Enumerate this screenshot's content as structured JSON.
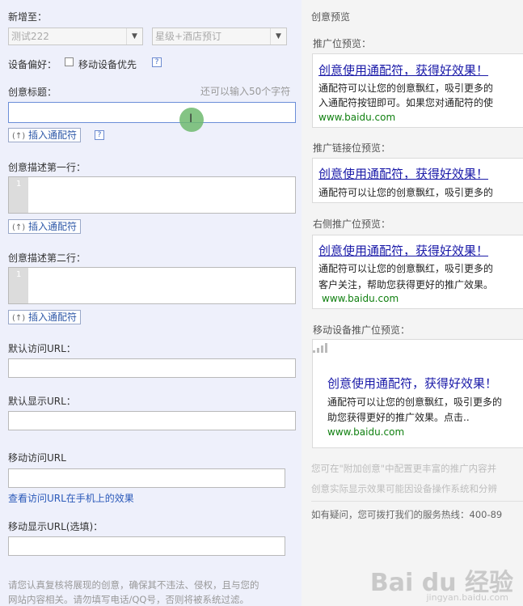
{
  "form": {
    "add_to_label": "新增至：",
    "plan_select": "测试222",
    "unit_select": "星级+酒店预订",
    "device_pref_label": "设备偏好：",
    "device_pref_option": "移动设备优先",
    "help_glyph": "?",
    "title_label": "创意标题：",
    "char_hint": "还可以输入50个字符",
    "insert_icon": "(↑)",
    "insert_wildcard": "插入通配符",
    "desc1_label": "创意描述第一行：",
    "desc2_label": "创意描述第二行：",
    "line_number": "1",
    "default_url_label": "默认访问URL：",
    "default_display_url_label": "默认显示URL：",
    "mobile_url_label": "移动访问URL",
    "view_url_link": "查看访问URL在手机上的效果",
    "mobile_display_url_label": "移动显示URL(选填)：",
    "notice_line1": "请您认真复核将展现的创意，确保其不违法、侵权，且与您的",
    "notice_line2": "网站内容相关。请勿填写电话/QQ号，否则将被系统过滤。"
  },
  "preview": {
    "header": "创意预览",
    "promo_label": "推广位预览：",
    "link_label": "推广链接位预览：",
    "right_label": "右侧推广位预览：",
    "mobile_label": "移动设备推广位预览：",
    "ad_title": "创意使用通配符，获得好效果！",
    "card1_desc1": "通配符可以让您的创意飘红，吸引更多的",
    "card1_desc2": "入通配符按钮即可。如果您对通配符的使",
    "card2_desc1": "通配符可以让您的创意飘红，吸引更多的",
    "card3_desc1": "通配符可以让您的创意飘红，吸引更多的",
    "card3_desc2": "客户关注，帮助您获得更好的推广效果。",
    "card4_desc1": "通配符可以让您的创意飘红，吸引更多的",
    "card4_desc2": "助您获得更好的推广效果。点击..",
    "url": "www.baidu.com",
    "note1": "您可在\"附加创意\"中配置更丰富的推广内容并",
    "note2": "创意实际显示效果可能因设备操作系统和分辨",
    "hotline": "如有疑问，您可拨打我们的服务热线：400-89"
  },
  "watermark": {
    "brand": "Bai du 经验",
    "domain": "jingyan.baidu.com"
  },
  "colors": {
    "left_bg": "#eef0fb",
    "right_bg": "#f4f4f4",
    "ad_title": "#1a1aa8",
    "ad_url": "#108010",
    "link": "#2a59b9"
  }
}
